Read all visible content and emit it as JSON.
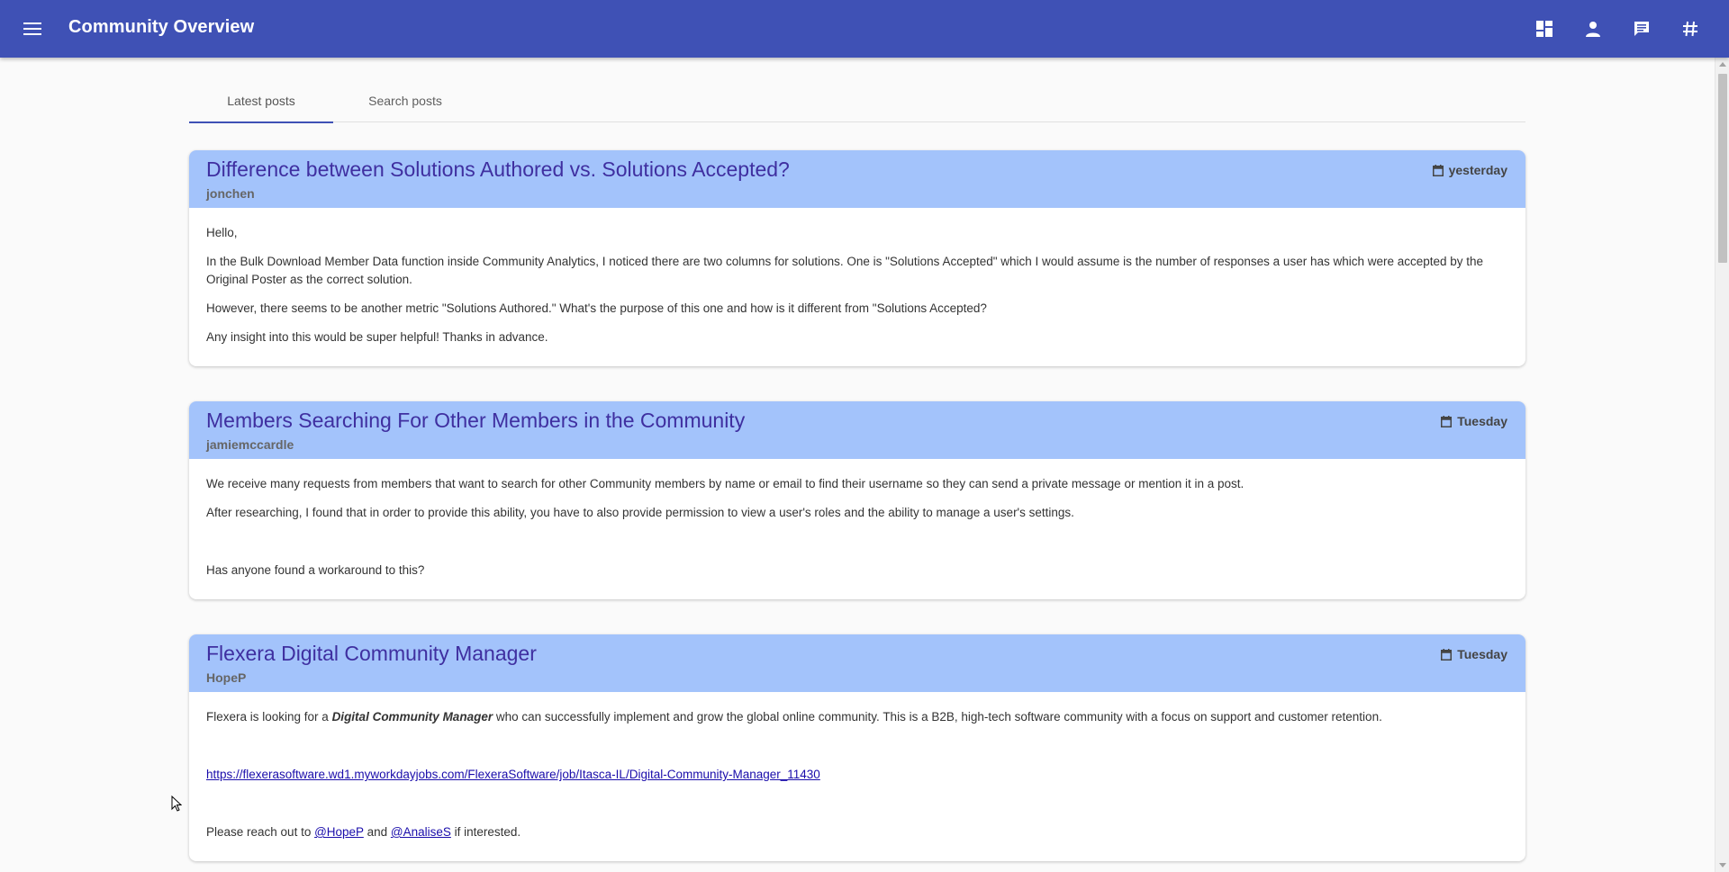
{
  "appbar": {
    "title": "Community Overview",
    "icons": [
      "menu-icon",
      "dashboard-icon",
      "person-icon",
      "chat-icon",
      "hashtag-icon"
    ],
    "color": "#3f51b5"
  },
  "tabs": [
    {
      "label": "Latest posts",
      "active": true
    },
    {
      "label": "Search posts",
      "active": false
    }
  ],
  "posts": [
    {
      "title": "Difference between Solutions Authored vs. Solutions Accepted?",
      "author": "jonchen",
      "date": "yesterday",
      "body": [
        "Hello,",
        "In the Bulk Download Member Data function inside Community Analytics, I noticed there are two columns for solutions. One is \"Solutions Accepted\" which I would assume is the number of responses a user has which were accepted by the Original Poster as the correct solution.",
        "However, there seems to be another metric \"Solutions Authored.\" What's the purpose of this one and how is it different from \"Solutions Accepted?",
        "Any insight into this would be super helpful! Thanks in advance."
      ]
    },
    {
      "title": "Members Searching For Other Members in the Community",
      "author": "jamiemccardle",
      "date": "Tuesday",
      "body": [
        "We receive many requests from members that want to search for other Community members by name or email to find their username so they can send a private message or mention it in a post.",
        "After researching, I found that in order to provide this ability, you have to also provide permission to view a user's roles and the ability to manage a user's settings.",
        "Has anyone found a workaround to this?"
      ]
    },
    {
      "title": "Flexera Digital Community Manager",
      "author": "HopeP",
      "date": "Tuesday",
      "body": {
        "intro_prefix": "Flexera is looking for a ",
        "intro_emphasis": "Digital Community Manager",
        "intro_suffix": " who can successfully implement and grow the global online community. This is a B2B, high-tech software community with a focus on support and customer retention.",
        "link": "https://flexerasoftware.wd1.myworkdayjobs.com/FlexeraSoftware/job/Itasca-IL/Digital-Community-Manager_11430",
        "contact_prefix": "Please reach out to ",
        "mention_1": "@HopeP",
        "contact_and": " and ",
        "mention_2": "@AnaliseS",
        "contact_suffix": " if interested."
      }
    }
  ],
  "colors": {
    "card_header": "#a3c3fb",
    "title_text": "#3f2fa0",
    "tab_indicator": "#3f51b5",
    "link": "#1a0dab"
  }
}
